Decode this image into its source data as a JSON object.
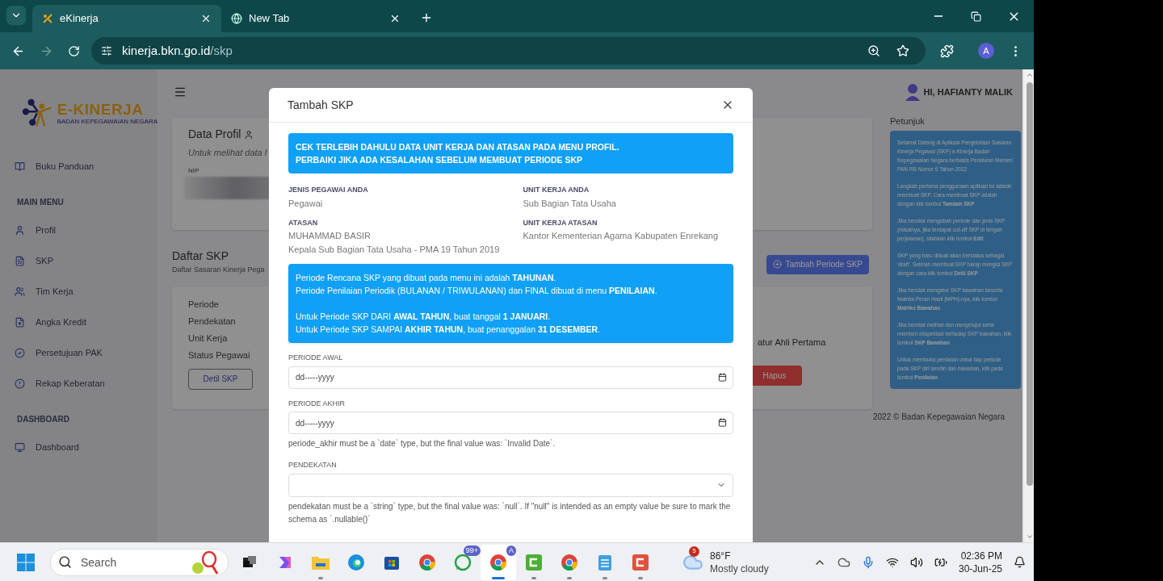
{
  "browser": {
    "tabs": [
      {
        "title": "eKinerja",
        "selected": true
      },
      {
        "title": "New Tab",
        "selected": false
      }
    ],
    "url": {
      "host": "kinerja.bkn.go.id",
      "path": "/skp"
    },
    "profile_initial": "A",
    "forward_disabled": true
  },
  "sidebar": {
    "logo": {
      "title": "E-KINERJA",
      "subtitle": "BADAN KEPEGAWAIAN NEGARA"
    },
    "sections": [
      {
        "items": [
          {
            "label": "Buku Panduan"
          }
        ]
      },
      {
        "heading": "MAIN MENU",
        "items": [
          {
            "label": "Profil"
          },
          {
            "label": "SKP"
          },
          {
            "label": "Tim Kerja"
          },
          {
            "label": "Angka Kredit"
          },
          {
            "label": "Persetujuan PAK"
          },
          {
            "label": "Rekap Keberatan"
          }
        ]
      },
      {
        "heading": "DASHBOARD",
        "items": [
          {
            "label": "Dashboard"
          }
        ]
      }
    ]
  },
  "header": {
    "greeting": "HI, HAFIANTY MALIK"
  },
  "profile_card": {
    "title": "Data Profil",
    "subtitle": "Untuk melihat data l",
    "nip_label": "NIP"
  },
  "skp_list": {
    "title": "Daftar SKP",
    "subtitle": "Daftar Sasaran Kinerja Pega",
    "add_button": "Tambah Periode SKP",
    "fields": [
      "Periode",
      "Pendekatan",
      "Unit Kerja",
      "Status Pegawai"
    ],
    "detail_button": "Detil SKP",
    "value_fragment": "atur Ahli Pertama",
    "delete_button": "Hapus"
  },
  "help": {
    "title": "Petunjuk",
    "paragraphs": [
      "Selamat Datang di Aplikasi Pengelolaan Sasaran Kinerja Pegawai (SKP) e-Kinerja Badan Kepegawaian Negara berbasis Peraturan Menteri PAN RB Nomor 6 Tahun 2022",
      "Langkah pertama penggunaan aplikasi ini adalah membuat SKP. Cara membuat SKP adalah dengan klik tombol **Tambah SKP**",
      "Jika hendak mengubah periode dan jenis SKP (misalnya, jika terdapat cut-off SKP di tengah perjalanan), silahkan klik tombol **Edit**",
      "SKP yang baru dibuat akan berstatus sebagai 'draft'. Setelah membuat SKP harap mengisi SKP dengan cara klik tombol **Detil SKP**",
      "Jika hendak mengatur SKP bawahan beserta Matriks Peran Hasil (MPH)-nya, klik tombol **Matriks Bawahan**",
      "Jika hendak melihat dan menyetujui serta memberi ekspektasi terhadap SKP bawahan, klik tombol **SKP Bawahan**",
      "Untuk membuka penilaian untuk tiap periode pada SKP diri sendiri dan bawahan, klik pada tombol **Penilaian**"
    ]
  },
  "footer": "2022 © Badan Kepegawaian Negara",
  "modal": {
    "title": "Tambah SKP",
    "warning": [
      "CEK TERLEBIH DAHULU DATA UNIT KERJA DAN ATASAN PADA MENU PROFIL.",
      "PERBAIKI JIKA ADA KESALAHAN SEBELUM MEMBUAT PERIODE SKP"
    ],
    "info": [
      {
        "label": "JENIS PEGAWAI ANDA",
        "values": [
          "Pegawai"
        ]
      },
      {
        "label": "UNIT KERJA ANDA",
        "values": [
          "Sub Bagian Tata Usaha"
        ]
      },
      {
        "label": "ATASAN",
        "values": [
          "MUHAMMAD BASIR",
          "Kepala Sub Bagian Tata Usaha - PMA 19 Tahun 2019"
        ]
      },
      {
        "label": "UNIT KERJA ATASAN",
        "values": [
          "Kantor Kementerian Agama Kabupaten Enrekang"
        ]
      }
    ],
    "notice": [
      [
        "Periode Rencana SKP yang dibuat pada menu ini adalah **TAHUNAN**.",
        "Periode Penilaian Periodik (BULANAN / TRIWULANAN) dan FINAL dibuat di menu **PENILAIAN**."
      ],
      [
        "Untuk Periode SKP DARI **AWAL TAHUN**, buat tanggal **1 JANUARI**.",
        "Untuk Periode SKP SAMPAI **AKHIR TAHUN**, buat penanggalan **31 DESEMBER**."
      ]
    ],
    "fields": [
      {
        "kind": "date",
        "label": "PERIODE AWAL",
        "placeholder": "dd-----yyyy"
      },
      {
        "kind": "date",
        "label": "PERIODE AKHIR",
        "placeholder": "dd-----yyyy",
        "error": "periode_akhir must be a `date` type, but the final value was: `Invalid Date`."
      },
      {
        "kind": "select",
        "label": "PENDEKATAN",
        "error": "pendekatan must be a `string` type, but the final value was: `null`. If \"null\" is intended as an empty value be sure to mark the schema as `.nullable()`"
      }
    ]
  },
  "taskbar": {
    "search_placeholder": "Search",
    "apps": [
      {
        "kind": "taskview",
        "open": false,
        "selected": false
      },
      {
        "kind": "copilot",
        "open": false,
        "selected": false
      },
      {
        "kind": "explorer",
        "open": true,
        "selected": false
      },
      {
        "kind": "edge",
        "open": false,
        "selected": false
      },
      {
        "kind": "store",
        "open": false,
        "selected": false
      },
      {
        "kind": "chrome",
        "open": false,
        "selected": false
      },
      {
        "kind": "whatsapp",
        "open": false,
        "selected": false,
        "badge": "99+"
      },
      {
        "kind": "chrome",
        "open": true,
        "selected": true,
        "badge": "A"
      },
      {
        "kind": "camtasia-green",
        "open": true,
        "selected": false
      },
      {
        "kind": "chrome",
        "open": true,
        "selected": false
      },
      {
        "kind": "notepad",
        "open": true,
        "selected": false
      },
      {
        "kind": "camtasia-red",
        "open": true,
        "selected": false
      }
    ],
    "weather": {
      "badge": "5",
      "temperature": "86°F",
      "condition": "Mostly cloudy"
    },
    "time": "02:36 PM",
    "date": "30-Jun-25"
  }
}
